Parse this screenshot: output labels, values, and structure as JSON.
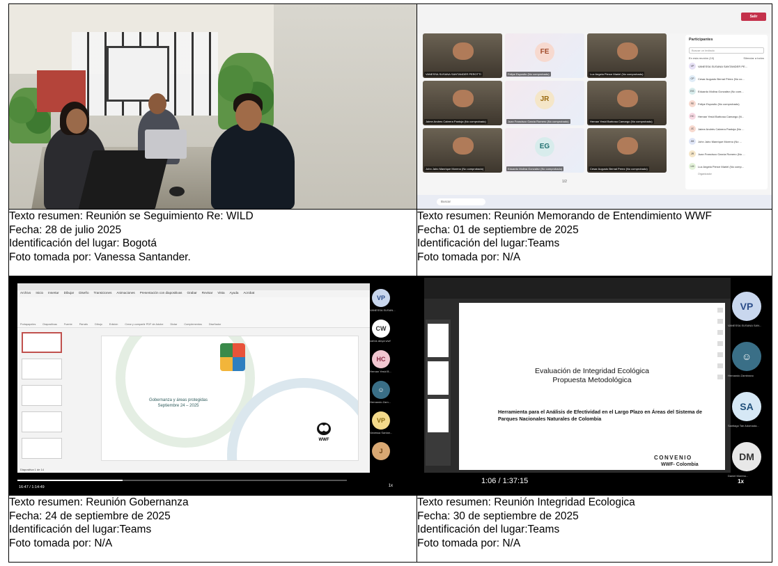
{
  "cells": [
    {
      "resumen": "Texto resumen: Reunión se Seguimiento Re: WILD",
      "fecha": "Fecha: 28 de julio 2025",
      "lugar": "Identificación del lugar:  Bogotá",
      "foto": "Foto tomada por: Vanessa Santander."
    },
    {
      "resumen": "Texto resumen: Reunión Memorando de Entendimiento WWF",
      "fecha": "Fecha: 01 de septiembre de 2025",
      "lugar": "Identificación del lugar:Teams",
      "foto": "Foto tomada por: N/A"
    },
    {
      "resumen": "Texto resumen: Reunión Gobernanza",
      "fecha": "Fecha: 24 de septiembre de 2025",
      "lugar": "Identificación del lugar:Teams",
      "foto": "Foto tomada por: N/A"
    },
    {
      "resumen": "Texto resumen: Reunión Integridad Ecologica",
      "fecha": "Fecha: 30 de septiembre de 2025",
      "lugar": "Identificación del lugar:Teams",
      "foto": "Foto tomada por: N/A"
    }
  ],
  "teams": {
    "leave_label": "Salir",
    "tiles": [
      {
        "initials": "",
        "name": "VANESSA SUSANA SANTANDER PEROTTI",
        "dark": true
      },
      {
        "initials": "FE",
        "name": "Felipe Esposito (No comprobado)",
        "dark": false,
        "color": "#f7d9cf",
        "text_color": "#a04a2a"
      },
      {
        "initials": "",
        "name": "Luz Angela Pierce Mariel (No comprobado)",
        "dark": true
      },
      {
        "initials": "",
        "name": "Jaime Andres Cabrera Pantoja (No comprobado)",
        "dark": true
      },
      {
        "initials": "JR",
        "name": "Juan Francisco Garcia Romero (No comprobado)",
        "dark": false,
        "color": "#f5e6c8",
        "text_color": "#9a6a10"
      },
      {
        "initials": "",
        "name": "Hernan Yesid Barbosa Camargo (No comprobado)",
        "dark": true
      },
      {
        "initials": "",
        "name": "John Jairo Manrique Moreno (No comprobado)",
        "dark": true
      },
      {
        "initials": "EG",
        "name": "Eduardo Molina Gonzalez (No comprobado)",
        "dark": false,
        "color": "#d8ecec",
        "text_color": "#1f6f6f"
      },
      {
        "initials": "",
        "name": "Cesar Augusto Bernal Perez (No comprobado)",
        "dark": true
      }
    ],
    "page_indicator": "1/2",
    "panel_title": "Participantes",
    "search_placeholder": "Buscar un invitado",
    "section": "En esta reunión (10)",
    "mute_all": "Silenciar a todos",
    "participants": [
      {
        "initials": "VP",
        "name": "VANESSA SUSANA SANTANDER PE...",
        "color": "#e6e0f5"
      },
      {
        "initials": "CP",
        "name": "Cesar Augusto Bernal Pérez (No co...",
        "color": "#e0ecf7"
      },
      {
        "initials": "EG",
        "name": "Eduardo Molina Gonzalez (No com...",
        "color": "#d8ecec"
      },
      {
        "initials": "FE",
        "name": "Felipe Esposito (No comprobado)",
        "color": "#f7d9cf"
      },
      {
        "initials": "HC",
        "name": "Hernan Yesid Barbosa Camargo (N...",
        "color": "#f7d9e3"
      },
      {
        "initials": "JC",
        "name": "Jaime Andrés Cabrera Pantoja (No ...",
        "color": "#f7d9cf"
      },
      {
        "initials": "JM",
        "name": "John Jairo Manrique Moreno (No ...",
        "color": "#e0e6f7"
      },
      {
        "initials": "JR",
        "name": "Juan Francisco García Romero (No ...",
        "color": "#f5e6c8"
      },
      {
        "initials": "LM",
        "name": "Luz Angela Pierce Mariel (No comp...",
        "color": "#e3f2d9"
      }
    ],
    "organizer": "Organizador",
    "search_box": "Buscar"
  },
  "ppt": {
    "menu": [
      "Archivo",
      "Inicio",
      "Insertar",
      "Dibujar",
      "Diseño",
      "Transiciones",
      "Animaciones",
      "Presentación con diapositivas",
      "Grabar",
      "Revisar",
      "Vista",
      "Ayuda",
      "Acrobat"
    ],
    "ribbon_groups": [
      "Portapapeles",
      "Diapositivas",
      "Fuente",
      "Párrafo",
      "Dibujo",
      "Edición",
      "Crear y compartir PDF de Adobe",
      "Dictar",
      "Complementos",
      "Diseñador"
    ],
    "slide_title": "Gobernanza y áreas protegidas",
    "slide_date": "Septiembre 24 – 2025",
    "wwf": "WWF",
    "status": "Diapositiva 1 de 14",
    "time": "16:47 / 1:14:49",
    "participants": [
      {
        "initials": "VP",
        "name": "VANESSA SUSAN...",
        "bg": "#c9d7ee",
        "fg": "#2c4d8a"
      },
      {
        "initials": "CW",
        "name": "carlos atoya wwf",
        "bg": "#ffffff",
        "fg": "#333333"
      },
      {
        "initials": "HC",
        "name": "Hernan Yesid B...",
        "bg": "#f1c6d0",
        "fg": "#8a2a44"
      },
      {
        "initials": "",
        "name": "Hernando Zam...",
        "bg": "#3a6f87",
        "fg": "#ffffff"
      },
      {
        "initials": "VP",
        "name": "Vanessa Santan...",
        "bg": "#f3d98a",
        "fg": "#8a6a10"
      },
      {
        "initials": "J",
        "name": "",
        "bg": "#d9a873",
        "fg": "#6a3f10"
      }
    ],
    "speed": "1x"
  },
  "acrobat": {
    "title_line1": "Evaluación de Integridad Ecológica",
    "title_line2": "Propuesta Metodológica",
    "subtitle": "Herramienta para  el Análisis de Efectividad en el Largo Plazo en Áreas del Sistema de Parques Nacionales Naturales de Colombia",
    "convenio": "CONVENIO",
    "org": "WWF- Colombia",
    "time": "1:06 / 1:37:15",
    "speed": "1x",
    "participants": [
      {
        "initials": "VP",
        "name": "VANESSA SUSANA SAN...",
        "bg": "#c9d7ee",
        "fg": "#2c4d8a"
      },
      {
        "initials": "",
        "name": "Hernando Zambrano",
        "bg": "#3a6f87",
        "fg": "#ffffff"
      },
      {
        "initials": "SA",
        "name": "Santiago Tan Adomada...",
        "bg": "#d6e8f5",
        "fg": "#1f4f7a"
      },
      {
        "initials": "DM",
        "name": "Daniel Moreno...",
        "bg": "#e8e8e8",
        "fg": "#333333"
      }
    ]
  }
}
